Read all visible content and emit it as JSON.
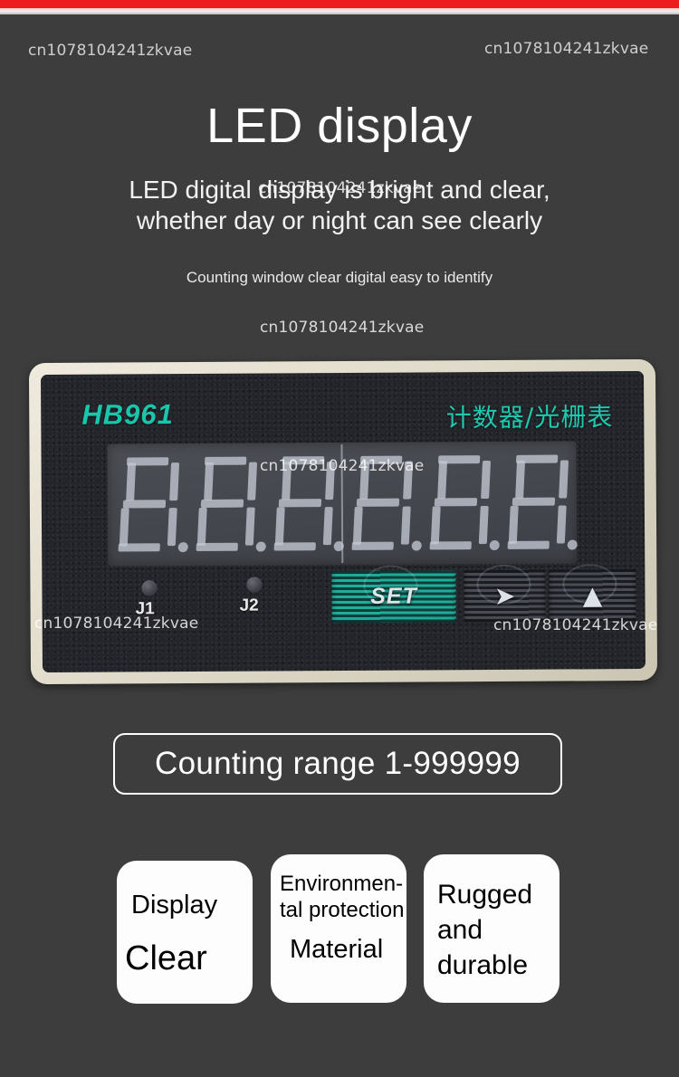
{
  "watermark": {
    "text": "cn1078104241zkvae"
  },
  "header": {
    "title": "LED display",
    "subtitle_line1": "LED digital display is bright and clear,",
    "subtitle_line2": "whether day or night can see clearly",
    "caption": "Counting window clear digital easy to identify"
  },
  "device": {
    "brand": "HB961",
    "chinese_label": "计数器/光栅表",
    "display_value": "8.8.8.8.8.8.",
    "digit_count": 6,
    "indicators": [
      {
        "label": "J1"
      },
      {
        "label": "J2"
      }
    ],
    "buttons": [
      {
        "name": "set",
        "label": "SET"
      },
      {
        "name": "shift",
        "glyph": "➤"
      },
      {
        "name": "increment",
        "glyph": "▲"
      }
    ]
  },
  "range_banner": {
    "text": "Counting range 1-999999"
  },
  "feature_cards": [
    {
      "line1": "Display",
      "line2": "Clear"
    },
    {
      "line1": "Environmen-\ntal protection",
      "line2": "Material"
    },
    {
      "line1": "Rugged\nand\ndurable",
      "line2": ""
    }
  ],
  "colors": {
    "accent_red": "#ee1d1d",
    "background": "#3d3d3d",
    "brand_teal": "#19c6ac",
    "bezel": "#e3decd",
    "faceplate": "#24252a",
    "card_bg": "#fdfdfd"
  }
}
